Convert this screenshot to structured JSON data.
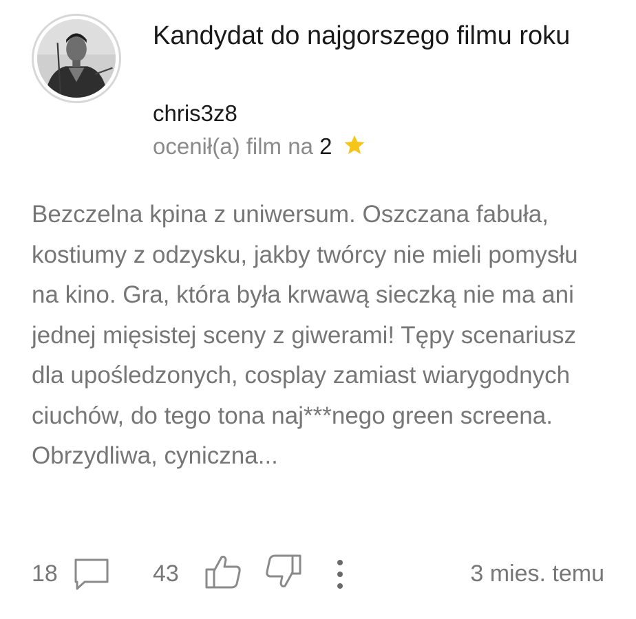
{
  "review": {
    "title": "Kandydat do najgorszego filmu roku",
    "author": "chris3z8",
    "rating_prefix": "ocenił(a) film na ",
    "rating_value": "2",
    "body": "Bezczelna kpina z uniwersum. Oszczana fabuła, kostiumy z odzysku, jakby twórcy nie mieli pomysłu na kino. Gra, która była krwawą sieczką nie ma ani jednej mięsistej sceny z giwerami! Tępy scenariusz dla upośledzonych, cosplay zamiast wiarygodnych ciuchów, do tego tona naj***nego green screena. Obrzydliwa, cyniczna..."
  },
  "footer": {
    "comments_count": "18",
    "likes_count": "43",
    "time_ago": "3 mies. temu"
  },
  "icons": {
    "star": "star-icon",
    "comment": "comment-icon",
    "like": "thumbs-up-icon",
    "dislike": "thumbs-down-icon",
    "more": "more-vertical-icon"
  },
  "colors": {
    "star": "#F5C518",
    "text_primary": "#1a1a1a",
    "text_muted": "#767676",
    "icon_gray": "#8a8a8a"
  }
}
